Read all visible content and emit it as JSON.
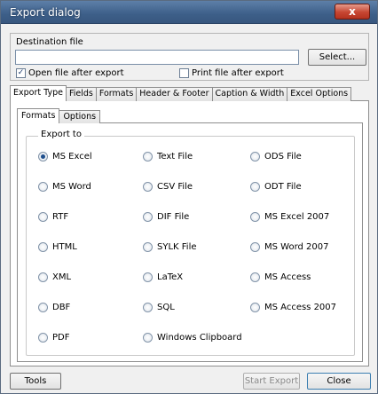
{
  "window": {
    "title": "Export dialog",
    "close_glyph": "x"
  },
  "destination": {
    "label": "Destination file",
    "value": "",
    "select_label": "Select...",
    "open_after_export": {
      "label": "Open file after export",
      "checked": true
    },
    "print_after_export": {
      "label": "Print file after export",
      "checked": false
    }
  },
  "outer_tabs": [
    "Export Type",
    "Fields",
    "Formats",
    "Header & Footer",
    "Caption & Width",
    "Excel Options"
  ],
  "inner_tabs": [
    "Formats",
    "Options"
  ],
  "export_to": {
    "label": "Export to",
    "selected": "MS Excel",
    "options": [
      "MS Excel",
      "Text File",
      "ODS File",
      "MS Word",
      "CSV File",
      "ODT File",
      "RTF",
      "DIF File",
      "MS Excel 2007",
      "HTML",
      "SYLK File",
      "MS Word 2007",
      "XML",
      "LaTeX",
      "MS Access",
      "DBF",
      "SQL",
      "MS Access 2007",
      "PDF",
      "Windows Clipboard"
    ]
  },
  "buttons": {
    "tools": "Tools",
    "start_export": "Start Export",
    "close": "Close"
  },
  "colors": {
    "titlebar": "#3d5f89",
    "close": "#c74632",
    "radio_selected": "#1f4f8d"
  }
}
